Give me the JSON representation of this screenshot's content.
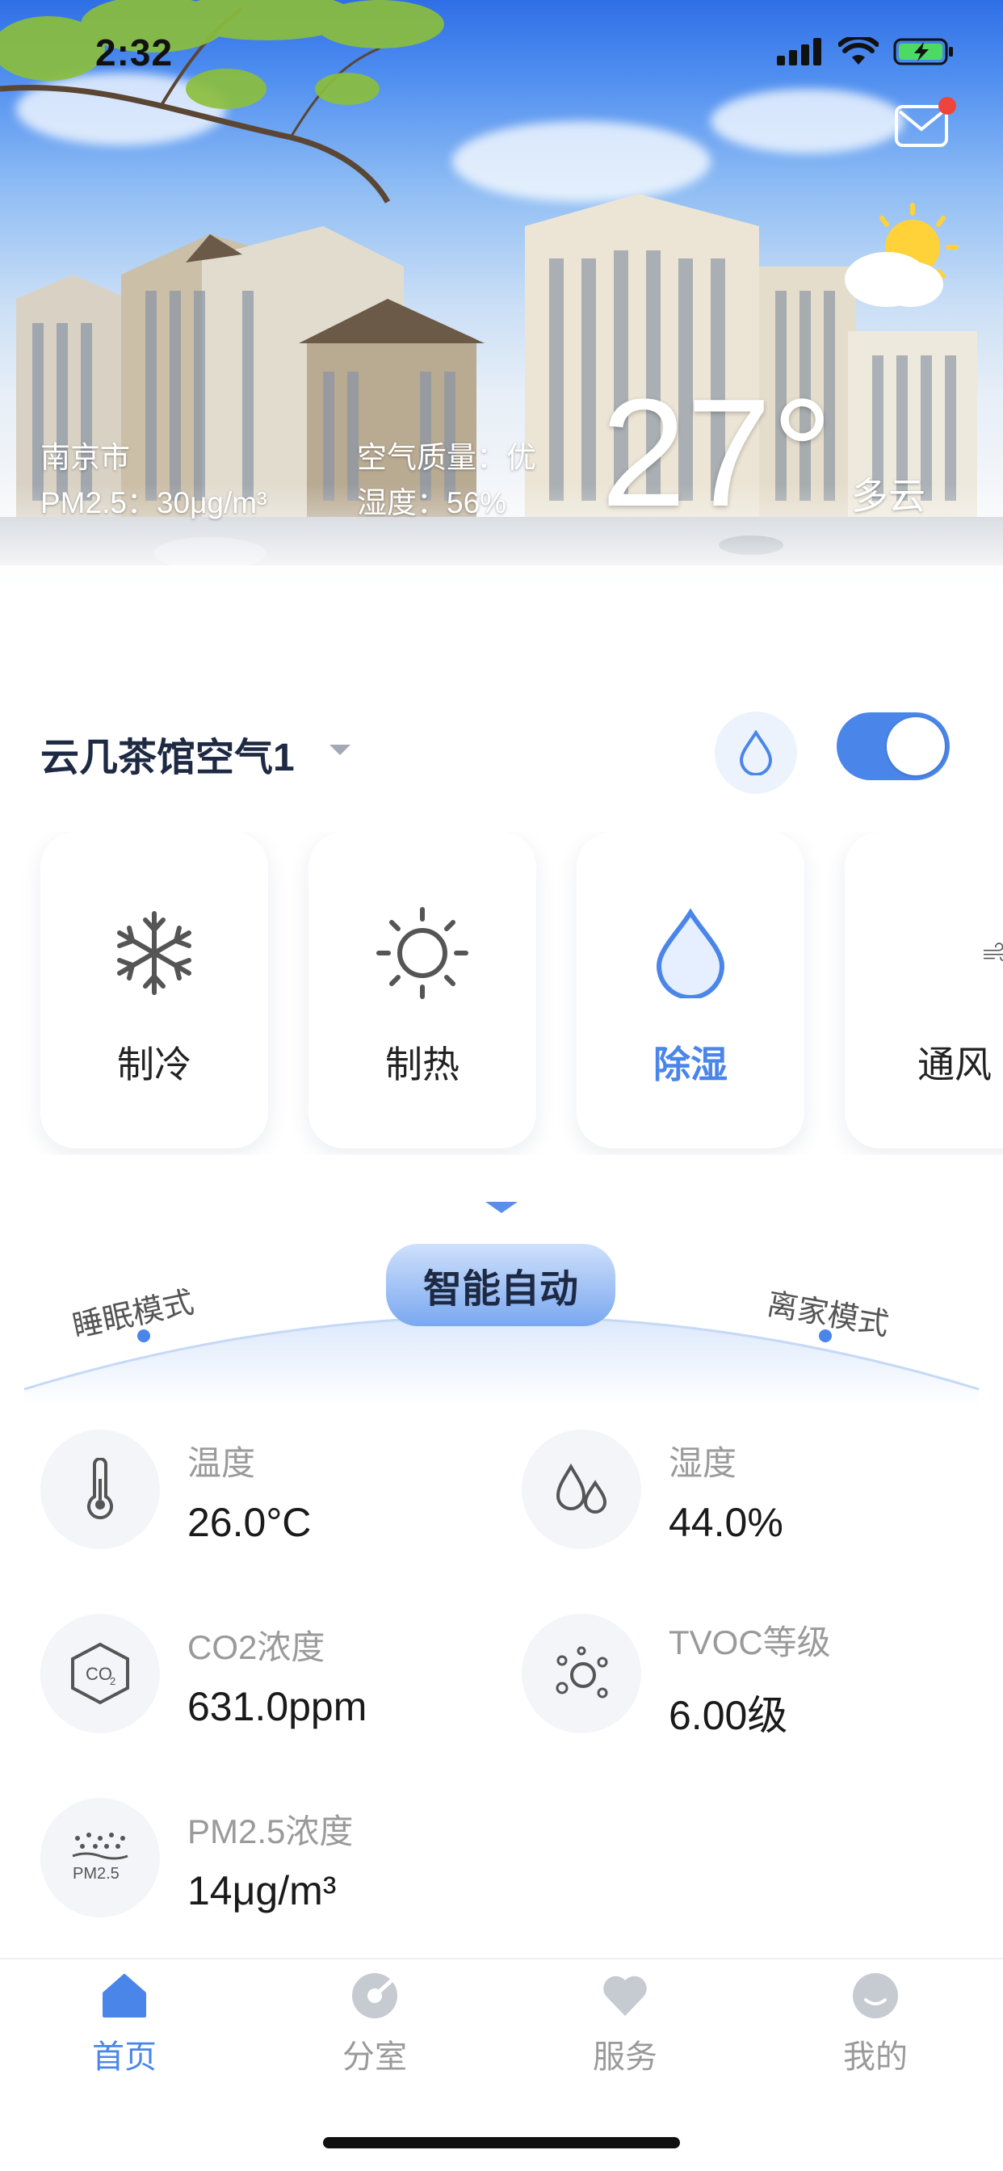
{
  "status_bar": {
    "time": "2:32"
  },
  "weather": {
    "city": "南京市",
    "pm25": "PM2.5：30μg/m³",
    "air_quality": "空气质量：优",
    "humidity": "湿度：56%",
    "temperature": "27°",
    "condition": "多云"
  },
  "device": {
    "name": "云几茶馆空气1",
    "power_on": true
  },
  "modes": [
    {
      "label": "制冷",
      "icon": "snowflake-icon",
      "active": false
    },
    {
      "label": "制热",
      "icon": "sun-icon",
      "active": false
    },
    {
      "label": "除湿",
      "icon": "water-drop-icon",
      "active": true
    },
    {
      "label": "通风",
      "icon": "wind-icon",
      "active": false
    }
  ],
  "scene_modes": {
    "left": "睡眠模式",
    "center": "智能自动",
    "right": "离家模式"
  },
  "metrics": {
    "temperature": {
      "label": "温度",
      "value": "26.0°C",
      "icon": "thermometer-icon"
    },
    "humidity": {
      "label": "湿度",
      "value": "44.0%",
      "icon": "humidity-icon"
    },
    "co2": {
      "label": "CO2浓度",
      "value": "631.0ppm",
      "icon": "co2-icon"
    },
    "tvoc": {
      "label": "TVOC等级",
      "value": "6.00级",
      "icon": "tvoc-icon"
    },
    "pm25": {
      "label": "PM2.5浓度",
      "value": "14μg/m³",
      "icon": "pm25-icon"
    },
    "co2_icon_text": "CO",
    "co2_icon_sub": "2",
    "pm25_icon_text": "PM2.5"
  },
  "tabs": [
    {
      "label": "首页",
      "icon": "home-icon",
      "active": true
    },
    {
      "label": "分室",
      "icon": "room-icon",
      "active": false
    },
    {
      "label": "服务",
      "icon": "heart-icon",
      "active": false
    },
    {
      "label": "我的",
      "icon": "profile-icon",
      "active": false
    }
  ],
  "colors": {
    "accent": "#4a86ea",
    "text": "#1e2a44",
    "muted": "#9a9a9a"
  }
}
